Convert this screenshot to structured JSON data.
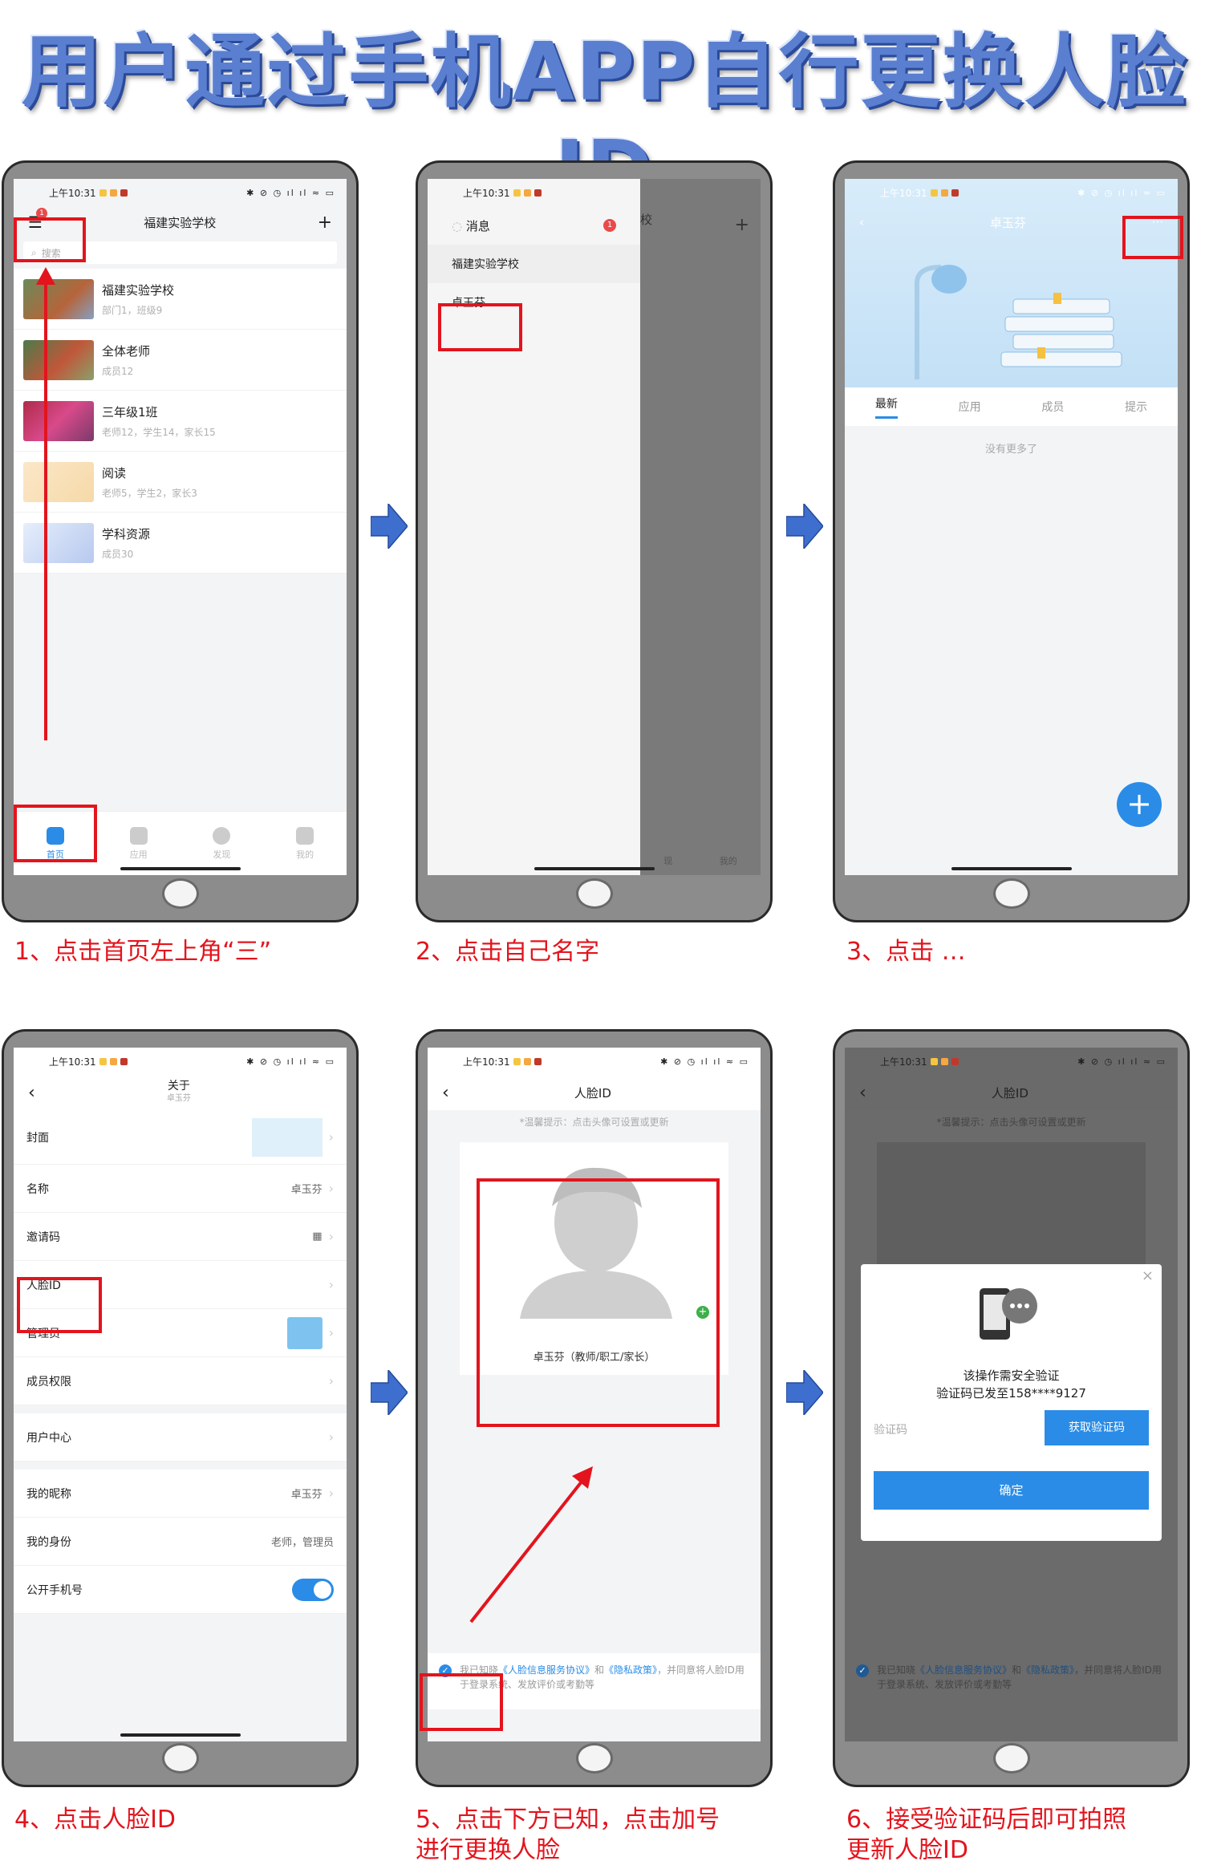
{
  "title": "用户通过手机APP自行更换人脸ID",
  "status": {
    "time": "上午10:31",
    "icons": "✱ ⊘ ◷ ıl ıl ≈ ▭"
  },
  "step1": {
    "caption": "1、点击首页左上角“三”",
    "nav_title": "福建实验学校",
    "menu_badge": "1",
    "search_placeholder": "搜索",
    "groups": [
      {
        "name": "福建实验学校",
        "sub": "部门1，班级9"
      },
      {
        "name": "全体老师",
        "sub": "成员12"
      },
      {
        "name": "三年级1班",
        "sub": "老师12，学生14，家长15"
      },
      {
        "name": "阅读",
        "sub": "老师5，学生2，家长3"
      },
      {
        "name": "学科资源",
        "sub": "成员30"
      }
    ],
    "tabs": [
      "首页",
      "应用",
      "发现",
      "我的"
    ]
  },
  "step2": {
    "caption": "2、点击自己名字",
    "messages": "消息",
    "msg_badge": "1",
    "school": "福建实验学校",
    "name": "卓玉芬",
    "tabs": [
      "现",
      "我的"
    ]
  },
  "step3": {
    "caption": "3、点击 …",
    "nav_title": "卓玉芬",
    "tabs": [
      "最新",
      "应用",
      "成员",
      "提示"
    ],
    "empty": "没有更多了"
  },
  "step4": {
    "caption": "4、点击人脸ID",
    "nav_title": "关于",
    "nav_sub": "卓玉芬",
    "rows": [
      {
        "label": "封面",
        "value": ""
      },
      {
        "label": "名称",
        "value": "卓玉芬"
      },
      {
        "label": "邀请码",
        "value": "▦"
      },
      {
        "label": "人脸ID",
        "value": ""
      },
      {
        "label": "管理员",
        "value": ""
      },
      {
        "label": "成员权限",
        "value": ""
      },
      {
        "label": "用户中心",
        "value": ""
      },
      {
        "label": "我的昵称",
        "value": "卓玉芬"
      },
      {
        "label": "我的身份",
        "value": "老师，管理员"
      },
      {
        "label": "公开手机号",
        "value": ""
      }
    ]
  },
  "step5": {
    "caption_line1": "5、点击下方已知，点击加号",
    "caption_line2": "进行更换人脸",
    "nav_title": "人脸ID",
    "tip": "*温馨提示：点击头像可设置或更新",
    "person": "卓玉芬（教师/职工/家长）",
    "consent_pre": "我已知晓",
    "consent_link1": "《人脸信息服务协议》",
    "consent_and": "和",
    "consent_link2": "《隐私政策》",
    "consent_post": "，并同意将人脸ID用于登录系统、发放评价或考勤等"
  },
  "step6": {
    "caption_line1": "6、接受验证码后即可拍照",
    "caption_line2": "更新人脸ID",
    "nav_title": "人脸ID",
    "tip": "*温馨提示：点击头像可设置或更新",
    "modal_line1": "该操作需安全验证",
    "modal_line2": "验证码已发至158****9127",
    "code_placeholder": "验证码",
    "get_code": "获取验证码",
    "confirm": "确定",
    "consent_pre": "我已知晓",
    "consent_link1": "《人脸信息服务协议》",
    "consent_and": "和",
    "consent_link2": "《隐私政策》",
    "consent_post": "，并同意将人脸ID用于登录系统、发放评价或考勤等"
  },
  "colors": {
    "accent": "#2a8ce6",
    "highlight": "#e3141d",
    "title": "#5b7fd0"
  }
}
